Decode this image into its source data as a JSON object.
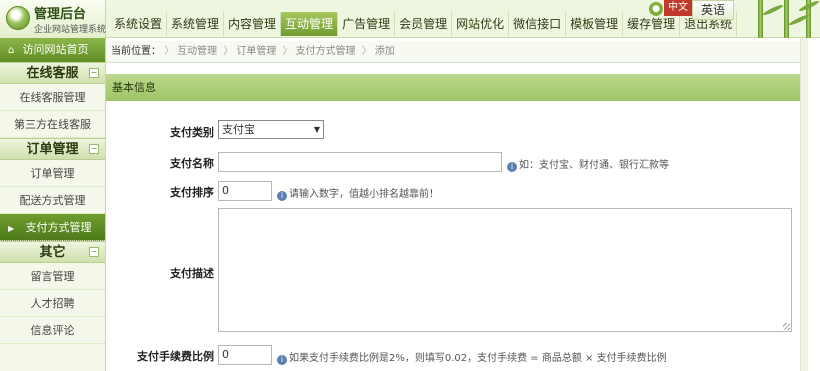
{
  "header": {
    "app_title": "管理后台",
    "app_subtitle": "企业网站管理系统",
    "nav": [
      {
        "label": "系统设置",
        "active": false
      },
      {
        "label": "系统管理",
        "active": false
      },
      {
        "label": "内容管理",
        "active": false
      },
      {
        "label": "互动管理",
        "active": true
      },
      {
        "label": "广告管理",
        "active": false
      },
      {
        "label": "会员管理",
        "active": false
      },
      {
        "label": "网站优化",
        "active": false
      },
      {
        "label": "微信接口",
        "active": false
      },
      {
        "label": "模板管理",
        "active": false
      },
      {
        "label": "缓存管理",
        "active": false
      },
      {
        "label": "退出系统",
        "active": false
      }
    ],
    "lang_cn": "中文",
    "lang_en": "英语",
    "accent_color": "#6f9b2f",
    "lang_cn_color": "#c0392b"
  },
  "sidebar": {
    "home_label": "访问网站首页",
    "groups": [
      {
        "title": "在线客服",
        "items": [
          {
            "label": "在线客服管理",
            "active": false
          },
          {
            "label": "第三方在线客服",
            "active": false
          }
        ]
      },
      {
        "title": "订单管理",
        "items": [
          {
            "label": "订单管理",
            "active": false
          },
          {
            "label": "配送方式管理",
            "active": false
          },
          {
            "label": "支付方式管理",
            "active": true
          }
        ]
      },
      {
        "title": "其它",
        "items": [
          {
            "label": "留言管理",
            "active": false
          },
          {
            "label": "人才招聘",
            "active": false
          },
          {
            "label": "信息评论",
            "active": false
          }
        ]
      }
    ]
  },
  "breadcrumb": {
    "prefix": "当前位置：",
    "items": [
      "互动管理",
      "订单管理",
      "支付方式管理",
      "添加"
    ]
  },
  "panel": {
    "title": "基本信息"
  },
  "form": {
    "pay_type": {
      "label": "支付类别",
      "selected": "支付宝"
    },
    "pay_name": {
      "label": "支付名称",
      "value": "",
      "hint": "如：支付宝、财付通、银行汇款等"
    },
    "pay_order": {
      "label": "支付排序",
      "value": "0",
      "hint": "请输入数字，值越小排名越靠前！"
    },
    "pay_desc": {
      "label": "支付描述",
      "value": ""
    },
    "pay_fee": {
      "label": "支付手续费比例",
      "value": "0",
      "hint": "如果支付手续费比例是2%，则填写0.02，支付手续费 = 商品总额 × 支付手续费比例"
    }
  },
  "icons": {
    "home": "home-icon",
    "collapse": "minus-box-icon",
    "hint": "info-circle-icon",
    "select_caret": "caret-down-icon",
    "active_arrow": "caret-right-icon"
  }
}
